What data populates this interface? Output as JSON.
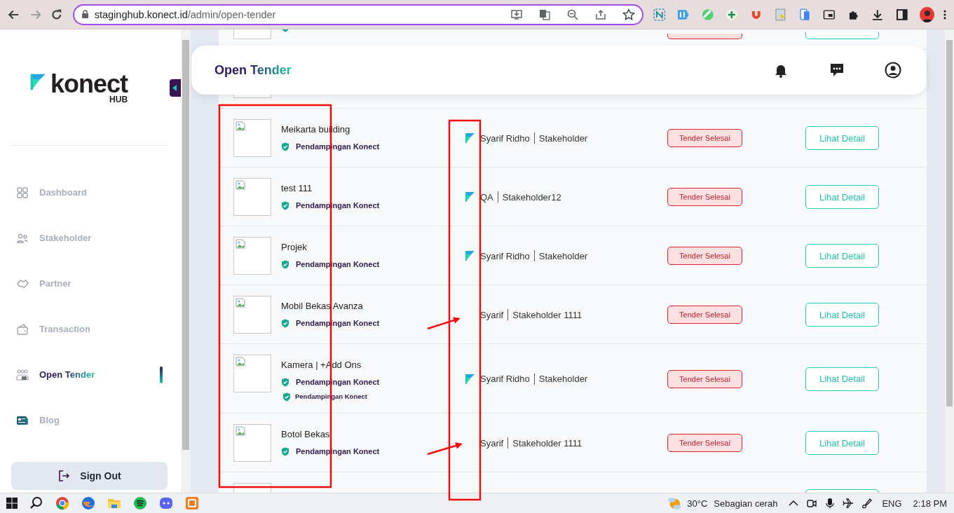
{
  "browser": {
    "url_host": "staginghub.konect.id",
    "url_path": "/admin/open-tender"
  },
  "sidebar": {
    "brand": "konect",
    "brand_sub": "HUB",
    "items": [
      {
        "label": "Dashboard",
        "selected": false
      },
      {
        "label": "Stakeholder",
        "selected": false
      },
      {
        "label": "Partner",
        "selected": false
      },
      {
        "label": "Transaction",
        "selected": false
      },
      {
        "label": "Open Tender",
        "selected": true
      },
      {
        "label": "Blog",
        "selected": false
      }
    ],
    "sign_out": "Sign Out"
  },
  "header": {
    "title": "Open Tender"
  },
  "rows": [
    {
      "kind": "partial-top"
    },
    {
      "kind": "covered"
    },
    {
      "kind": "full",
      "title": "Meikarta building",
      "badges": [
        {
          "label": "Pendampingan Konect",
          "kind": "regular"
        }
      ],
      "owner": {
        "logo": true,
        "name": "Syarif Ridho",
        "role": "Stakeholder"
      },
      "status": "Tender Selesai",
      "action": "Lihat Detail"
    },
    {
      "kind": "full",
      "title": "test 111",
      "badges": [
        {
          "label": "Pendampingan Konect",
          "kind": "regular"
        }
      ],
      "owner": {
        "logo": true,
        "name": "QA",
        "role": "Stakeholder12"
      },
      "status": "Tender Selesai",
      "action": "Lihat Detail"
    },
    {
      "kind": "full",
      "title": "Projek",
      "badges": [
        {
          "label": "Pendampingan Konect",
          "kind": "regular"
        }
      ],
      "owner": {
        "logo": true,
        "name": "Syarif Ridho",
        "role": "Stakeholder"
      },
      "status": "Tender Selesai",
      "action": "Lihat Detail"
    },
    {
      "kind": "full",
      "title": "Mobil Bekas Avanza",
      "badges": [
        {
          "label": "Pendampingan Konect",
          "kind": "regular"
        }
      ],
      "owner": {
        "logo": false,
        "name": "Syarif",
        "role": "Stakeholder 1111"
      },
      "status": "Tender Selesai",
      "action": "Lihat Detail"
    },
    {
      "kind": "full",
      "title": "Kamera | +Add Ons",
      "badges": [
        {
          "label": "Pendampingan Konect",
          "kind": "regular"
        },
        {
          "label": "Pendampingan Konect",
          "kind": "small"
        }
      ],
      "owner": {
        "logo": true,
        "name": "Syarif Ridho",
        "role": "Stakeholder"
      },
      "status": "Tender Selesai",
      "action": "Lihat Detail"
    },
    {
      "kind": "full",
      "title": "Botol Bekas",
      "badges": [
        {
          "label": "Pendampingan Konect",
          "kind": "regular"
        }
      ],
      "owner": {
        "logo": false,
        "name": "Syarif",
        "role": "Stakeholder 1111"
      },
      "status": "Tender Selesai",
      "action": "Lihat Detail"
    },
    {
      "kind": "partial-bottom"
    }
  ],
  "annotations": [
    {
      "kind": "frame"
    },
    {
      "kind": "frame"
    },
    {
      "kind": "arrow"
    },
    {
      "kind": "arrow"
    }
  ],
  "taskbar": {
    "temperature": "30°C",
    "weather": "Sebagian cerah",
    "language": "ENG",
    "time": "2:18 PM"
  }
}
